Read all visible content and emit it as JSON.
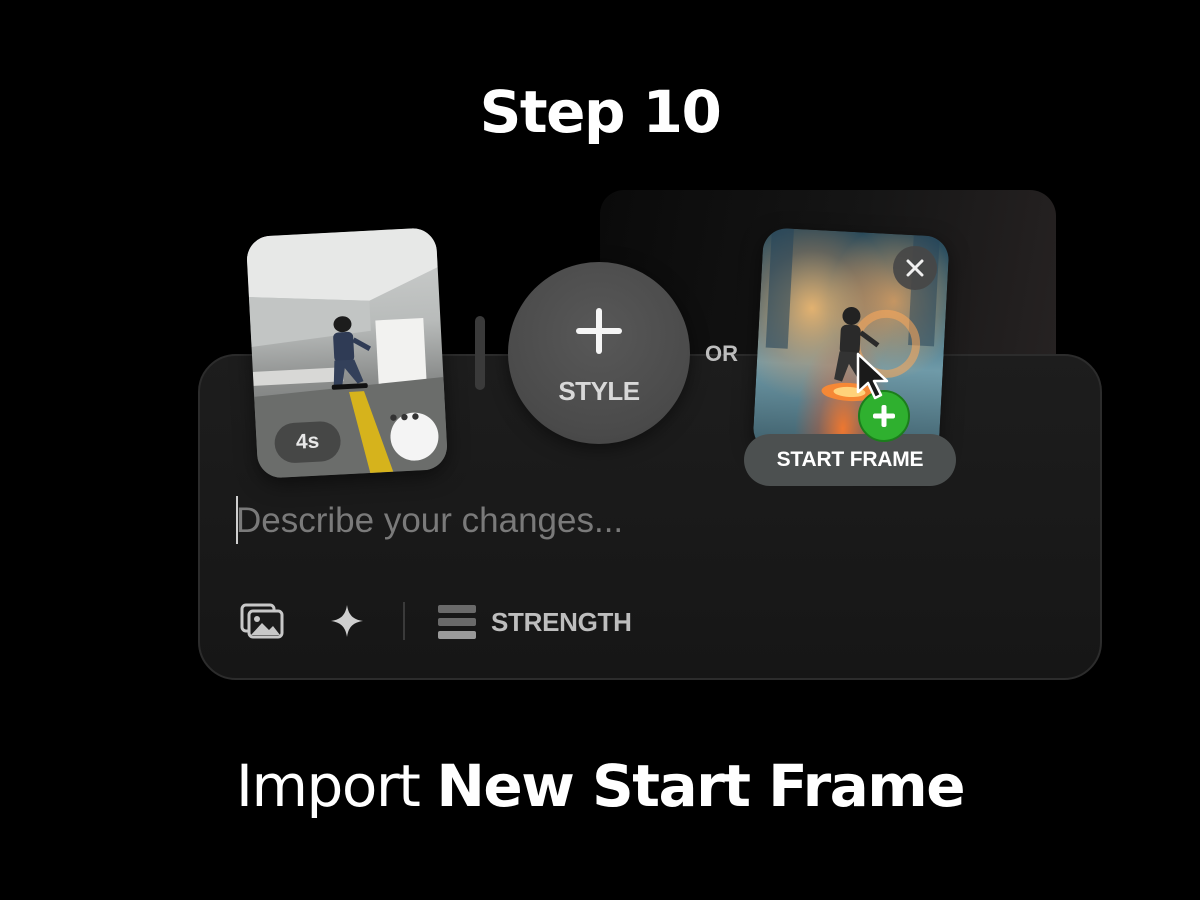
{
  "header": {
    "step_title": "Step 10"
  },
  "clip": {
    "duration": "4s"
  },
  "style_button": {
    "label": "STYLE"
  },
  "or_label": "OR",
  "start_frame": {
    "badge_label": "START FRAME"
  },
  "prompt": {
    "placeholder": "Describe your changes..."
  },
  "toolbar": {
    "images_icon": "images-icon",
    "sparkle_icon": "sparkle-icon",
    "strength_icon": "strength-bars-icon",
    "strength_label": "STRENGTH"
  },
  "caption": {
    "light": "Import",
    "bold": "New Start Frame"
  },
  "colors": {
    "background": "#000000",
    "panel": "#1b1b1b",
    "accent_green": "#2fb02f",
    "badge_gray": "#4c5050"
  }
}
